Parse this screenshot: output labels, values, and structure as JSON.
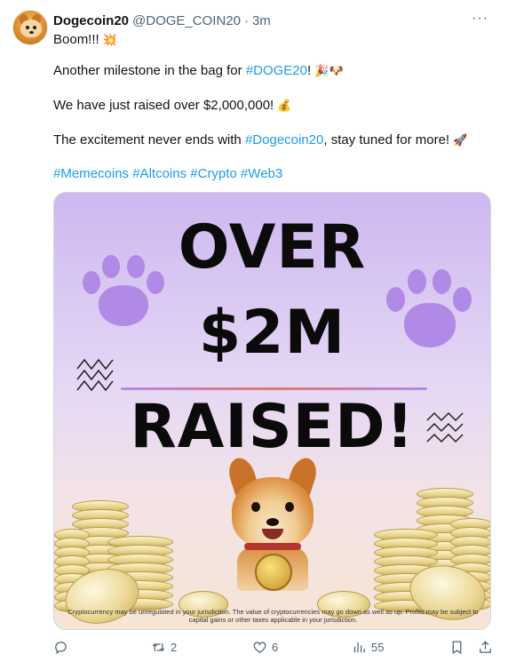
{
  "author": {
    "name": "Dogecoin20",
    "handle": "@DOGE_COIN20",
    "separator": "·",
    "time": "3m"
  },
  "tweet": {
    "line1": "Boom!!!",
    "line2_pre": "Another milestone in the bag for ",
    "line2_tag": "#DOGE20",
    "line2_post": "!",
    "line3": "We have just raised over $2,000,000!",
    "line4_pre": "The excitement never ends with ",
    "line4_tag": "#Dogecoin20",
    "line4_post": ", stay tuned for more!",
    "hashtags": [
      "#Memecoins",
      "#Altcoins",
      "#Crypto",
      "#Web3"
    ]
  },
  "media": {
    "headline_1": "OVER",
    "headline_2": "$2M",
    "headline_3": "RAISED!",
    "disclaimer": "Cryptocurrency may be unregulated in your jurisdiction. The value of cryptocurrencies may go down as well as up. Profits may be subject to capital gains or other taxes applicable in your jurisdiction."
  },
  "actions": {
    "reply_count": "",
    "retweet_count": "2",
    "like_count": "6",
    "views_count": "55"
  },
  "icons": [
    "more-icon",
    "reply-icon",
    "retweet-icon",
    "like-icon",
    "views-icon",
    "bookmark-icon"
  ],
  "colors": {
    "link": "#1d9bf0",
    "muted": "#536471",
    "paw": "#b08ae6"
  }
}
